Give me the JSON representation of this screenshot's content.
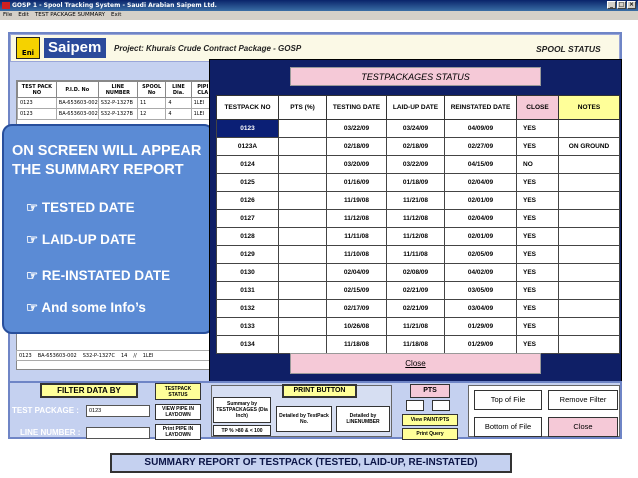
{
  "window": {
    "title": "GOSP 1 - Spool Tracking System - Saudi Arabian Saipem Ltd.",
    "menu": [
      "File",
      "Edit",
      "TEST PACKAGE SUMMARY",
      "Exit"
    ]
  },
  "header": {
    "eni_logo": "Eni",
    "saipem_logo": "Saipem",
    "project": "Project: Khurais Crude Contract Package - GOSP",
    "spool_status": "SPOOL STATUS"
  },
  "background_table": {
    "headers": [
      "TEST PACK NO",
      "P.I.D. No",
      "LINE NUMBER",
      "SPOOL No",
      "LINE Dia.",
      "PIPI CLA"
    ],
    "rows": [
      [
        "0123",
        "BA-653603-002",
        "S32-P-1327B",
        "11",
        "4",
        "1LEI"
      ],
      [
        "0123",
        "BA-653603-002",
        "S32-P-1327B",
        "12",
        "4",
        "1LEI"
      ]
    ],
    "last_row": [
      "0123",
      "BA-653603-002",
      "S32-P-1327C",
      "14",
      "//",
      "1LEI"
    ]
  },
  "callout": {
    "title": "ON SCREEN WILL APPEAR THE SUMMARY REPORT",
    "items": [
      "TESTED DATE",
      "LAID-UP DATE",
      "RE-INSTATED DATE",
      "And some Info’s"
    ],
    "bullet_icon": "pointing-hand-icon"
  },
  "dialog": {
    "title": "TESTPACKAGES STATUS",
    "headers": [
      "TESTPACK NO",
      "PTS (%)",
      "TESTING DATE",
      "LAID-UP DATE",
      "REINSTATED DATE",
      "CLOSE",
      "NOTES"
    ],
    "rows": [
      [
        "0123",
        "",
        "03/22/09",
        "03/24/09",
        "04/09/09",
        "YES",
        ""
      ],
      [
        "0123A",
        "",
        "02/18/09",
        "02/18/09",
        "02/27/09",
        "YES",
        "ON GROUND"
      ],
      [
        "0124",
        "",
        "03/20/09",
        "03/22/09",
        "04/15/09",
        "NO",
        ""
      ],
      [
        "0125",
        "",
        "01/16/09",
        "01/18/09",
        "02/04/09",
        "YES",
        ""
      ],
      [
        "0126",
        "",
        "11/19/08",
        "11/21/08",
        "02/01/09",
        "YES",
        ""
      ],
      [
        "0127",
        "",
        "11/12/08",
        "11/12/08",
        "02/04/09",
        "YES",
        ""
      ],
      [
        "0128",
        "",
        "11/11/08",
        "11/12/08",
        "02/01/09",
        "YES",
        ""
      ],
      [
        "0129",
        "",
        "11/10/08",
        "11/11/08",
        "02/05/09",
        "YES",
        ""
      ],
      [
        "0130",
        "",
        "02/04/09",
        "02/08/09",
        "04/02/09",
        "YES",
        ""
      ],
      [
        "0131",
        "",
        "02/15/09",
        "02/21/09",
        "03/05/09",
        "YES",
        ""
      ],
      [
        "0132",
        "",
        "02/17/09",
        "02/21/09",
        "03/04/09",
        "YES",
        ""
      ],
      [
        "0133",
        "",
        "10/26/08",
        "11/21/08",
        "01/29/09",
        "YES",
        ""
      ],
      [
        "0134",
        "",
        "11/18/08",
        "11/18/08",
        "01/29/09",
        "YES",
        ""
      ]
    ],
    "close_label": "Close"
  },
  "filter": {
    "title": "FILTER DATA BY",
    "test_package_label": "TEST PACKAGE :",
    "test_package_value": "0123",
    "line_number_label": "LINE NUMBER :",
    "line_number_value": ""
  },
  "testpack_status": {
    "title": "TESTPACK STATUS",
    "view_pipe": "VIEW PIPE IN LAYDOWN",
    "print_pipe": "Print PIPE IN LAYDOWN"
  },
  "print": {
    "title": "PRINT BUTTON",
    "summary": "Summary by TESTPACKAGES (Dia Inch)",
    "detailed_testpack": "Detailed by TestPack No.",
    "detailed_line": "Detailed by LINENUMBER",
    "tp_range": "TP % >80 & < 100"
  },
  "pts": {
    "title": "PTS",
    "view_paint": "View PAINT/PTS",
    "print_query": "Print Query"
  },
  "nav": {
    "top_of_file": "Top of File",
    "remove_filter": "Remove Filter",
    "bottom_of_file": "Bottom of File",
    "close": "Close"
  },
  "caption": "SUMMARY REPORT OF TESTPACK (TESTED, LAID-UP, RE-INSTATED)"
}
